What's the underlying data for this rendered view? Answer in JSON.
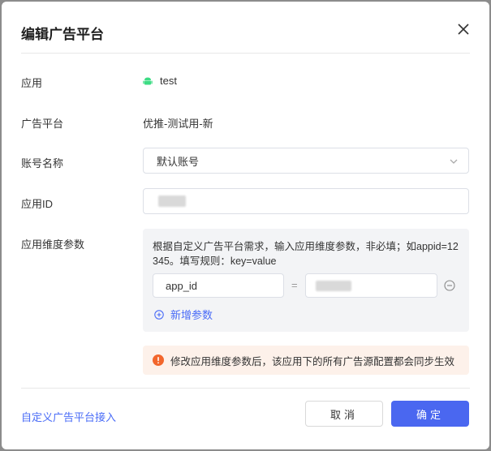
{
  "dialog": {
    "title": "编辑广告平台",
    "close_icon": "close-icon"
  },
  "fields": {
    "app_label": "应用",
    "app_value": "test",
    "app_icon": "android-icon",
    "platform_label": "广告平台",
    "platform_value": "优推-测试用-新",
    "account_label": "账号名称",
    "account_value": "默认账号",
    "appid_label": "应用ID",
    "dimension_label": "应用维度参数"
  },
  "dimension_panel": {
    "hint": "根据自定义广告平台需求，输入应用维度参数，非必填；如appid=12345。填写规则：key=value",
    "key_value": "app_id",
    "equals": "=",
    "add_label": "新增参数"
  },
  "warning": {
    "text": "修改应用维度参数后，该应用下的所有广告源配置都会同步生效"
  },
  "footer": {
    "link_label": "自定义广告平台接入",
    "cancel_label": "取消",
    "ok_label": "确定"
  },
  "colors": {
    "primary": "#4a67f0",
    "link": "#4a6cf7",
    "android_green": "#3ddc84",
    "warning_orange": "#f2662c"
  }
}
